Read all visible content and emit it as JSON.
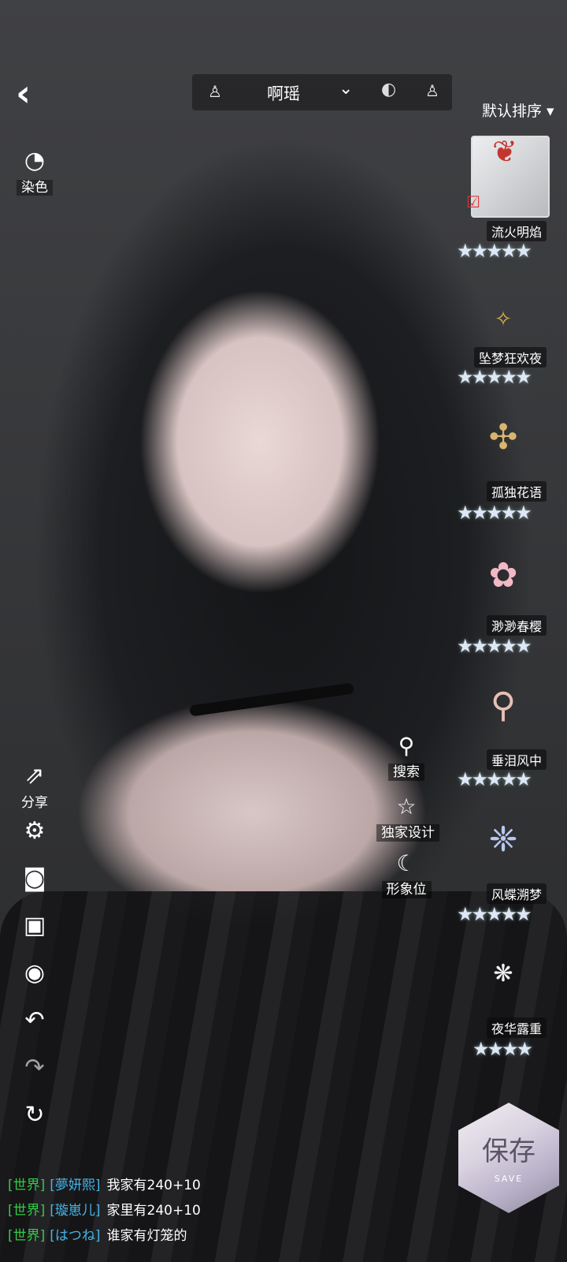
{
  "header": {
    "back_icon": "chevron-left-icon",
    "character_name": "啊瑶",
    "sort_label": "默认排序 ▾"
  },
  "left_toolbar": {
    "dye_label": "染色",
    "share_label": "分享"
  },
  "actions": {
    "search_label": "搜索",
    "exclusive_label": "独家设计",
    "image_slot_label": "形象位"
  },
  "items": [
    {
      "name": "流火明焰",
      "stars": "★★★★★"
    },
    {
      "name": "坠梦狂欢夜",
      "stars": "★★★★★"
    },
    {
      "name": "孤独花语",
      "stars": "★★★★★"
    },
    {
      "name": "渺渺春樱",
      "stars": "★★★★★"
    },
    {
      "name": "垂泪风中",
      "stars": "★★★★★"
    },
    {
      "name": "风蝶溯梦",
      "stars": "★★★★★"
    },
    {
      "name": "夜华露重",
      "stars": "★★★★"
    }
  ],
  "chat": [
    {
      "channel": "[世界]",
      "user": "[夢妍熙]",
      "message": "我家有240+10"
    },
    {
      "channel": "[世界]",
      "user": "[璇崽儿]",
      "message": "家里有240+10"
    },
    {
      "channel": "[世界]",
      "user": "[はつね]",
      "message": "谁家有灯笼的"
    }
  ],
  "save": {
    "label": "保存",
    "sub": "SAVE"
  },
  "colors": {
    "chat_channel": "#32cc46",
    "chat_user": "#46b4e6",
    "selected_accent": "#c3352f"
  }
}
